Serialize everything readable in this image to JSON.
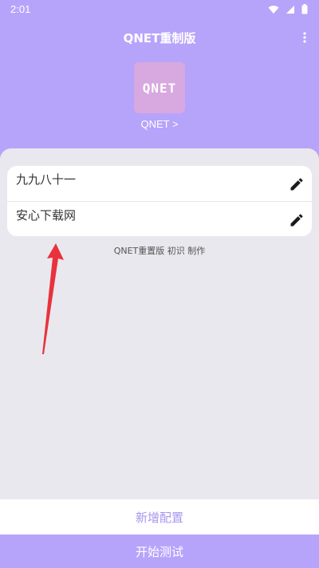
{
  "status_bar": {
    "time": "2:01",
    "icons": [
      "wifi-icon",
      "signal-icon",
      "battery-icon"
    ]
  },
  "app_bar": {
    "title": "QNET重制版",
    "menu_icon": "more-vert-icon"
  },
  "logo": {
    "text": "QNET",
    "link_label": "QNET >"
  },
  "configs": [
    {
      "name": "九九八十一",
      "action_icon": "edit-icon"
    },
    {
      "name": "安心下载网",
      "action_icon": "edit-icon"
    }
  ],
  "credits": "QNET重置版 初识 制作",
  "buttons": {
    "add_config": "新增配置",
    "start_test": "开始测试"
  },
  "colors": {
    "accent": "#b6a4fb",
    "sheet_background": "#e9e8ee",
    "logo_background": "#d8a8e0",
    "add_button_text": "#a895f0",
    "annotation_arrow": "#e8323c"
  }
}
